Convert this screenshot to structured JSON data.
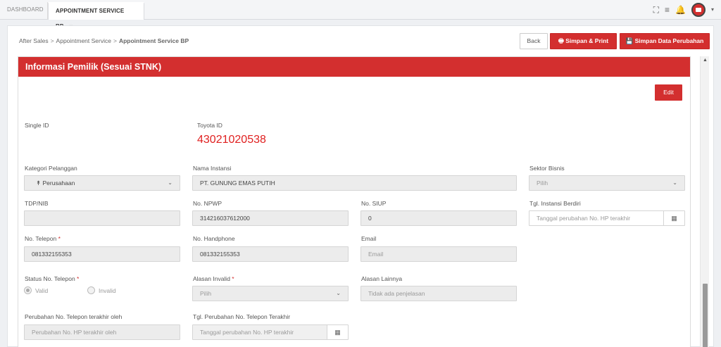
{
  "tabs": [
    {
      "label": "DASHBOARD"
    },
    {
      "label": "APPOINTMENT SERVICE BP",
      "close": "×"
    }
  ],
  "breadcrumb": {
    "items": [
      "After Sales",
      "Appointment Service"
    ],
    "current": "Appointment Service BP",
    "separator": ">"
  },
  "actions": {
    "back": "Back",
    "print": "Simpan & Print",
    "save": "Simpan Data Perubahan"
  },
  "panel": {
    "title": "Informasi Pemilik (Sesuai STNK)",
    "edit": "Edit"
  },
  "fields": {
    "single_id": {
      "label": "Single ID"
    },
    "toyota_id": {
      "label": "Toyota ID",
      "value": "43021020538"
    },
    "kategori": {
      "label": "Kategori Pelanggan",
      "value": "Perusahaan"
    },
    "nama_instansi": {
      "label": "Nama Instansi",
      "value": "PT. GUNUNG EMAS PUTIH"
    },
    "sektor": {
      "label": "Sektor Bisnis",
      "placeholder": "Pilih"
    },
    "tdp": {
      "label": "TDP/NIB",
      "value": ""
    },
    "npwp": {
      "label": "No. NPWP",
      "value": "314216037612000"
    },
    "siup": {
      "label": "No. SIUP",
      "value": "0"
    },
    "tgl_berdiri": {
      "label": "Tgl. Instansi Berdiri",
      "placeholder": "Tanggal perubahan No. HP terakhir"
    },
    "telepon": {
      "label": "No. Telepon",
      "required": "*",
      "value": "081332155353"
    },
    "handphone": {
      "label": "No. Handphone",
      "value": "081332155353"
    },
    "email": {
      "label": "Email",
      "placeholder": "Email"
    },
    "status_telepon": {
      "label": "Status No. Telepon",
      "required": "*",
      "options": [
        "Valid",
        "Invalid"
      ],
      "selected": "Valid"
    },
    "alasan_invalid": {
      "label": "Alasan Invalid",
      "required": "*",
      "placeholder": "Pilih"
    },
    "alasan_lainnya": {
      "label": "Alasan Lainnya",
      "placeholder": "Tidak ada penjelasan"
    },
    "perubahan_oleh": {
      "label": "Perubahan No. Telepon terakhir oleh",
      "placeholder": "Perubahan No. HP terakhir oleh"
    },
    "tgl_perubahan": {
      "label": "Tgl. Perubahan No. Telepon Terakhir",
      "placeholder": "Tanggal perubahan No. HP terakhir"
    }
  },
  "colors": {
    "accent": "#d32f2f",
    "toyota_id": "#e02020"
  },
  "icons": [
    "fullscreen-icon",
    "menu-icon",
    "bell-icon",
    "user-avatar-icon",
    "chevron-down-icon",
    "printer-icon",
    "save-icon",
    "calendar-icon",
    "tree-icon"
  ]
}
